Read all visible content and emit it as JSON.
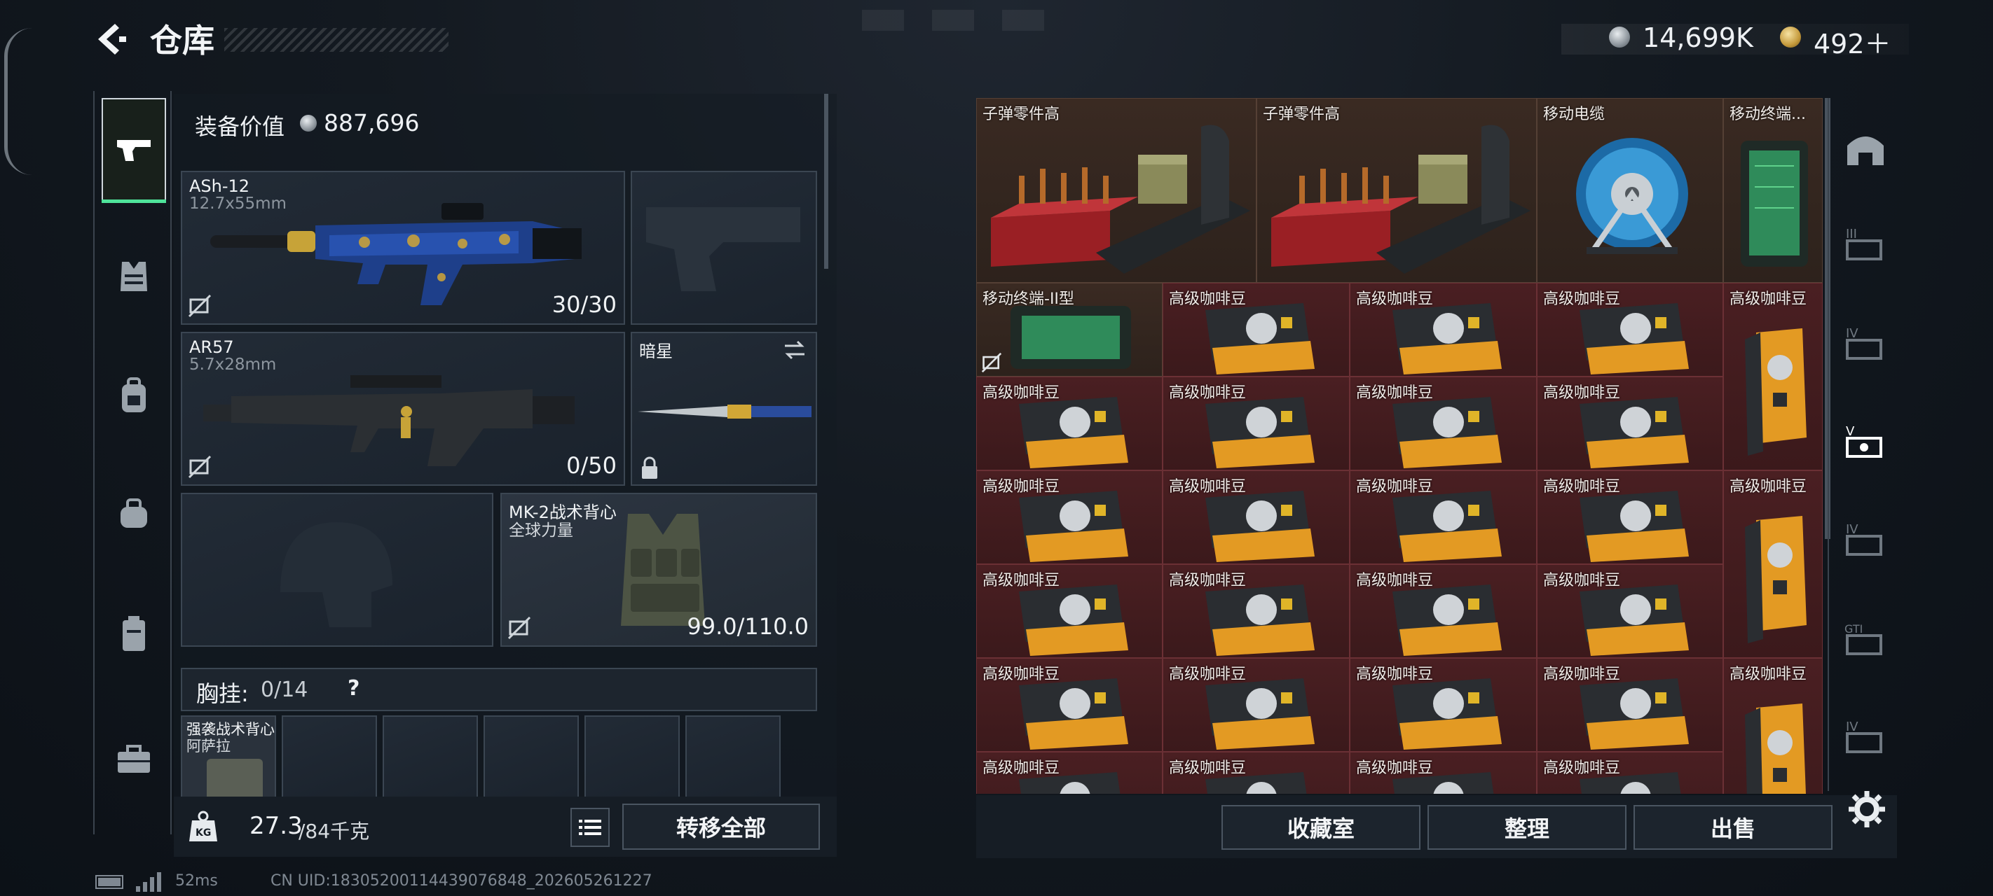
{
  "header": {
    "title": "仓库",
    "currency_silver": "14,699K",
    "currency_gold": "492＋"
  },
  "equipment": {
    "value_label": "装备价值",
    "value": "887,696",
    "primary_weapon": {
      "name": "ASh-12",
      "caliber": "12.7x55mm",
      "ammo": "30/30"
    },
    "secondary_weapon": {
      "name": "AR57",
      "caliber": "5.7x28mm",
      "ammo": "0/50"
    },
    "melee": {
      "name": "暗星"
    },
    "armor": {
      "name": "MK-2战术背心",
      "sub": "全球力量",
      "durability": "99.0/110.0"
    },
    "chest_rig": {
      "label": "胸挂:",
      "capacity": "0/14",
      "help": "?"
    },
    "rig_item": {
      "name": "强袭战术背心",
      "sub": "阿萨拉"
    },
    "weight": {
      "value": "27.3",
      "max": "/84千克"
    },
    "transfer_all": "转移全部"
  },
  "stash": {
    "items": [
      {
        "name": "子弹零件高"
      },
      {
        "name": "子弹零件高"
      },
      {
        "name": "移动电缆"
      },
      {
        "name": "移动终端..."
      },
      {
        "name": "移动终端-II型"
      },
      {
        "name": "高级咖啡豆"
      }
    ],
    "buttons": {
      "collection": "收藏室",
      "sort": "整理",
      "sell": "出售"
    }
  },
  "footer": {
    "ping": "52ms",
    "uid": "CN UID:18305200114439076848_202605261227"
  },
  "colors": {
    "accent_green": "#4fe39a",
    "panel_bg": "#1b2530",
    "rare_red": "#4a1f22",
    "epic_brown": "#3a2a22"
  },
  "icons": {
    "nav": [
      "pistol-icon",
      "vest-icon",
      "backpack-icon",
      "bag-icon",
      "case-icon",
      "toolbox-icon"
    ],
    "right_nav": [
      "arch-icon",
      "container-3-icon",
      "container-4-icon",
      "container-5-icon",
      "container-4b-icon",
      "gti-icon",
      "container-4c-icon",
      "settings-icon"
    ]
  }
}
